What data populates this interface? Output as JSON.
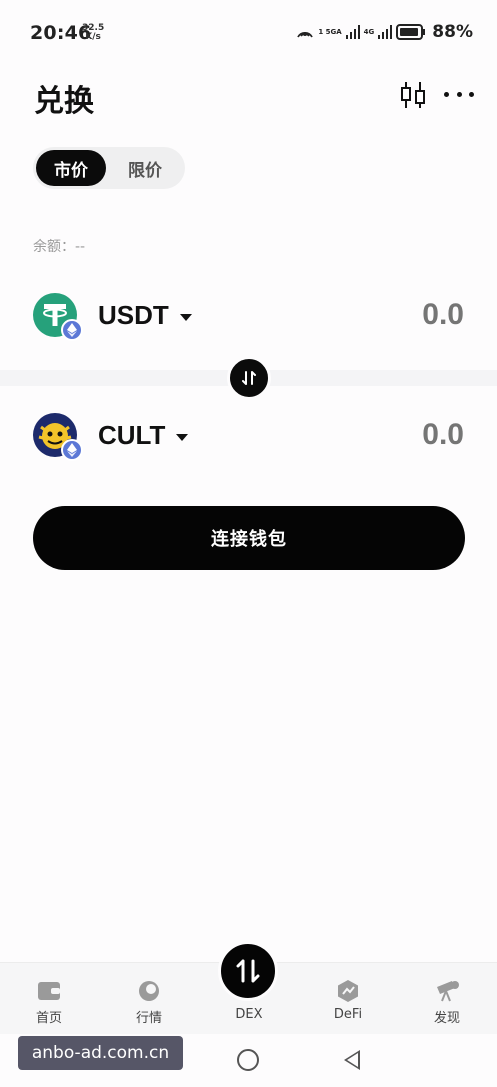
{
  "status_bar": {
    "time": "20:46",
    "speed_value": "32.5",
    "speed_unit": "K/s",
    "net1_label": "1 5GA",
    "net2_label": "4G",
    "battery_percent": "88%"
  },
  "header": {
    "title": "兑换"
  },
  "order_type": {
    "market_label": "市价",
    "limit_label": "限价",
    "selected": "market"
  },
  "balance": {
    "label": "余额：--"
  },
  "from_token": {
    "symbol": "USDT",
    "amount_placeholder": "0.0",
    "icon": "tether-icon",
    "chain_icon": "ethereum-icon"
  },
  "to_token": {
    "symbol": "CULT",
    "amount_placeholder": "0.0",
    "icon": "cult-token-icon",
    "chain_icon": "ethereum-icon"
  },
  "actions": {
    "connect_wallet_label": "连接钱包"
  },
  "bottom_nav": {
    "items": [
      {
        "label": "首页",
        "icon": "wallet-icon"
      },
      {
        "label": "行情",
        "icon": "market-icon"
      },
      {
        "label": "DEX",
        "icon": "swap-icon",
        "active": true
      },
      {
        "label": "DeFi",
        "icon": "defi-icon"
      },
      {
        "label": "发现",
        "icon": "telescope-icon"
      }
    ]
  },
  "watermark": {
    "text": "anbo-ad.com.cn"
  },
  "colors": {
    "primary": "#050505",
    "tether_green": "#26a17b",
    "eth_blue": "#5c78d6",
    "placeholder": "#e0e0e2",
    "muted_text": "#9a9a9a"
  }
}
